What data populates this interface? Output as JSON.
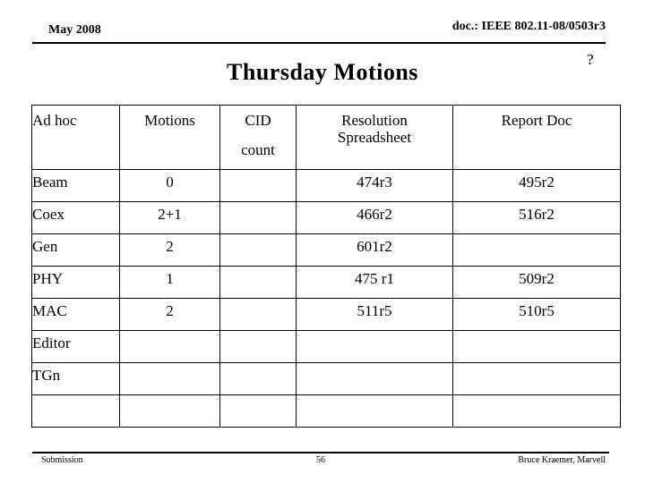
{
  "header": {
    "left": "May 2008",
    "right": "doc.: IEEE 802.11-08/0503r3"
  },
  "title": "Thursday Motions",
  "question_mark": "?",
  "table": {
    "columns": [
      {
        "key": "adhoc",
        "label": "Ad hoc"
      },
      {
        "key": "motions",
        "label": "Motions"
      },
      {
        "key": "cid_line1",
        "label": "CID"
      },
      {
        "key": "cid_line2",
        "label": "count"
      },
      {
        "key": "res_line1",
        "label": "Resolution"
      },
      {
        "key": "res_line2",
        "label": "Spreadsheet"
      },
      {
        "key": "report",
        "label": "Report Doc"
      }
    ],
    "rows": [
      {
        "adhoc": "Beam",
        "motions": "0",
        "cid": "",
        "resolution": "474r3",
        "report": "495r2"
      },
      {
        "adhoc": "Coex",
        "motions": "2+1",
        "cid": "",
        "resolution": "466r2",
        "report": "516r2"
      },
      {
        "adhoc": "Gen",
        "motions": "2",
        "cid": "",
        "resolution": "601r2",
        "report": ""
      },
      {
        "adhoc": "PHY",
        "motions": "1",
        "cid": "",
        "resolution": "475 r1",
        "report": "509r2"
      },
      {
        "adhoc": "MAC",
        "motions": "2",
        "cid": "",
        "resolution": "511r5",
        "report": "510r5"
      },
      {
        "adhoc": "Editor",
        "motions": "",
        "cid": "",
        "resolution": "",
        "report": ""
      },
      {
        "adhoc": "TGn",
        "motions": "",
        "cid": "",
        "resolution": "",
        "report": ""
      },
      {
        "adhoc": "",
        "motions": "",
        "cid": "",
        "resolution": "",
        "report": ""
      }
    ]
  },
  "footer": {
    "left": "Submission",
    "page": "56",
    "right": "Bruce Kraemer, Marvell"
  },
  "colors": {
    "text": "#000000",
    "background": "#ffffff",
    "rule": "#000000"
  }
}
